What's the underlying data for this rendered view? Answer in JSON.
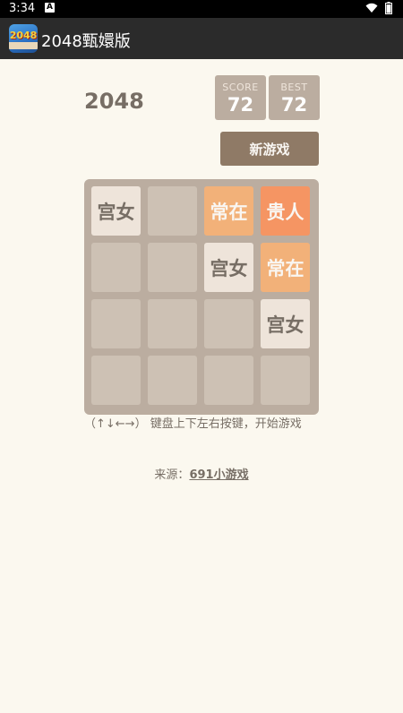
{
  "status_bar": {
    "time": "3:34",
    "notification_glyph": "A"
  },
  "app_bar": {
    "title": "2048甄嬛版",
    "icon_text": "2048"
  },
  "game": {
    "title": "2048",
    "score_label": "SCORE",
    "score": "72",
    "best_label": "BEST",
    "best": "72",
    "new_game_label": "新游戏"
  },
  "board": {
    "rows": [
      [
        "宫女",
        "",
        "常在",
        "贵人"
      ],
      [
        "",
        "",
        "宫女",
        "常在"
      ],
      [
        "",
        "",
        "",
        "宫女"
      ],
      [
        "",
        "",
        "",
        ""
      ]
    ],
    "tile_styles": {
      "宫女": {
        "bg": "#eee4da",
        "fg": "#776e65"
      },
      "常在": {
        "bg": "#f2b179",
        "fg": "#f9f6f2"
      },
      "贵人": {
        "bg": "#f59563",
        "fg": "#f9f6f2"
      },
      "": {
        "bg": "#cdc1b4",
        "fg": "#776e65"
      }
    }
  },
  "instructions": "（↑↓←→） 键盘上下左右按键，开始游戏",
  "source": {
    "label": "来源：",
    "link": "691小游戏"
  },
  "colors": {
    "background": "#fbf8ef",
    "board": "#bbada0",
    "empty_tile": "#cdc1b4",
    "button": "#8f7a66",
    "text": "#776e65"
  }
}
